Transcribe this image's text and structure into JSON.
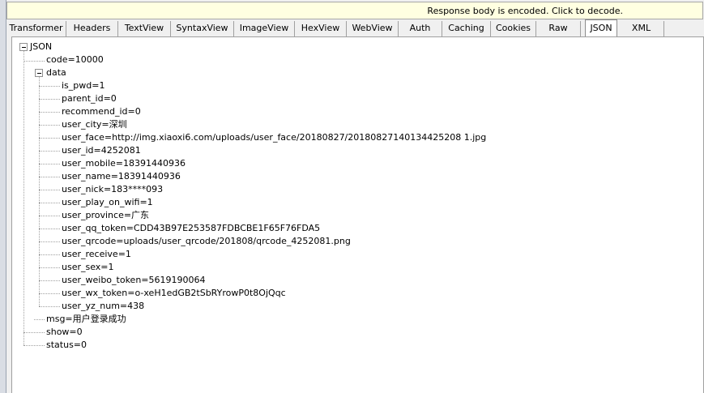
{
  "banner": {
    "text": "Response body is encoded. Click to decode."
  },
  "tabs": [
    {
      "label": "Transformer"
    },
    {
      "label": "Headers"
    },
    {
      "label": "TextView"
    },
    {
      "label": "SyntaxView"
    },
    {
      "label": "ImageView"
    },
    {
      "label": "HexView"
    },
    {
      "label": "WebView"
    },
    {
      "label": "Auth"
    },
    {
      "label": "Caching"
    },
    {
      "label": "Cookies"
    },
    {
      "label": "Raw"
    },
    {
      "label": "JSON",
      "active": true
    },
    {
      "label": "XML"
    }
  ],
  "tree": {
    "root": "JSON",
    "code": "code=10000",
    "data": "data",
    "data_items": [
      "is_pwd=1",
      "parent_id=0",
      "recommend_id=0",
      "user_city=深圳",
      "user_face=http://img.xiaoxi6.com/uploads/user_face/20180827/20180827140134425208 1.jpg",
      "user_id=4252081",
      "user_mobile=18391440936",
      "user_name=18391440936",
      "user_nick=183****093",
      "user_play_on_wifi=1",
      "user_province=广东",
      "user_qq_token=CDD43B97E253587FDBCBE1F65F76FDA5",
      "user_qrcode=uploads/user_qrcode/201808/qrcode_4252081.png",
      "user_receive=1",
      "user_sex=1",
      "user_weibo_token=5619190064",
      "user_wx_token=o-xeH1edGB2tSbRYrowP0t8OjQqc",
      "user_yz_num=438"
    ],
    "msg": "msg=用户登录成功",
    "show": "show=0",
    "status": "status=0"
  }
}
